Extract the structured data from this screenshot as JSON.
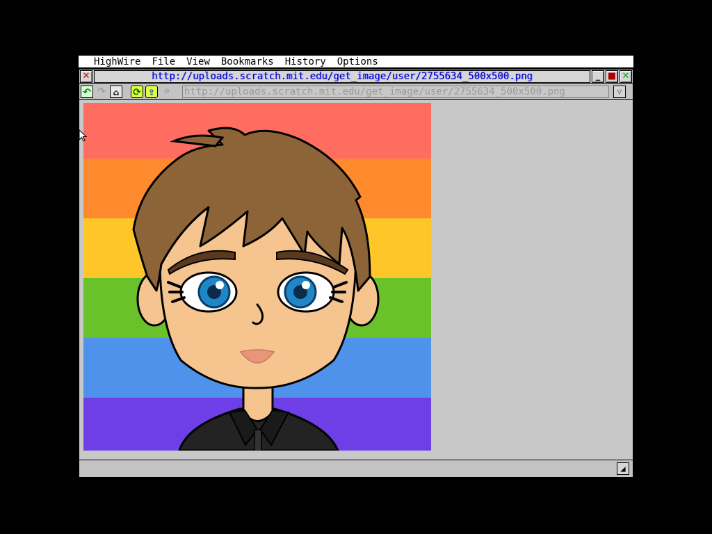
{
  "menubar": {
    "items": [
      "HighWire",
      "File",
      "View",
      "Bookmarks",
      "History",
      "Options"
    ]
  },
  "window": {
    "title": "http://uploads.scratch.mit.edu/get_image/user/2755634_500x500.png",
    "close_glyph": "✕",
    "minimize_glyph": "_",
    "fuller_glyph": "■",
    "iconify_glyph": "✕"
  },
  "toolbar": {
    "back_glyph": "↶",
    "forward_glyph": "↷",
    "home_glyph": "⌂",
    "reload_glyph": "⟳",
    "open_glyph": "⇪",
    "stop_glyph": "⊘",
    "url_value": "http://uploads.scratch.mit.edu/get_image/user/2755634_500x500.png",
    "dropdown_glyph": "▽"
  },
  "statusbar": {
    "text": "",
    "resize_glyph": "◢"
  },
  "image": {
    "stripe_colors": [
      "#ff6d61",
      "#ff8a2e",
      "#ffc629",
      "#6ac22b",
      "#4f92ec",
      "#6e3fe6"
    ],
    "hair_color": "#8d6437",
    "skin_color": "#f5c48f",
    "eye_color": "#1f87c8",
    "shirt_color": "#232323"
  },
  "icons": {
    "close": "close-icon",
    "minimize": "minimize-icon",
    "fuller": "fuller-icon",
    "iconify": "iconify-icon",
    "back": "back-arrow-icon",
    "forward": "forward-arrow-icon",
    "home": "home-icon",
    "reload": "reload-icon",
    "open": "open-folder-icon",
    "stop": "stop-icon",
    "dropdown": "triangle-down-icon",
    "resize": "resize-icon",
    "cursor": "mouse-pointer-icon"
  }
}
